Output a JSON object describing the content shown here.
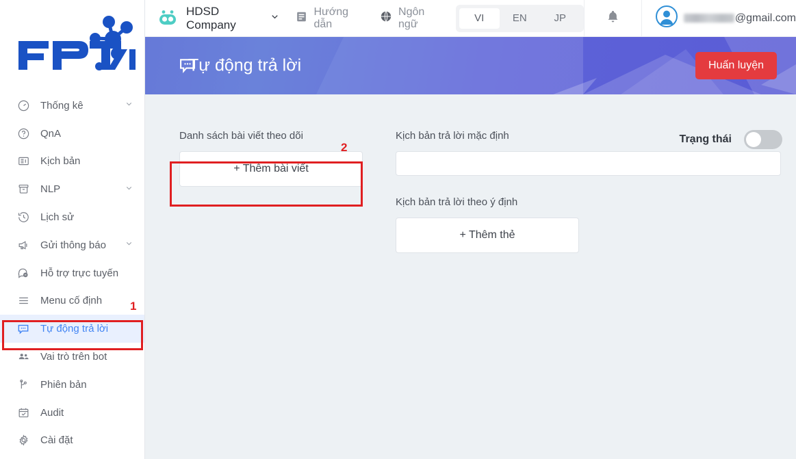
{
  "brand": {
    "logo_text": "FPT.AI",
    "accent": "#1a52c4"
  },
  "header": {
    "bot_icon": "robot-icon",
    "company": "HDSD Company",
    "company_chevron": "chevron-down-icon",
    "guide_label": "Hướng dẫn",
    "guide_icon": "document-icon",
    "language_label": "Ngôn ngữ",
    "language_icon": "globe-icon",
    "languages": [
      {
        "code": "VI",
        "selected": true
      },
      {
        "code": "EN",
        "selected": false
      },
      {
        "code": "JP",
        "selected": false
      }
    ],
    "notification_icon": "bell-icon",
    "avatar_icon": "user-avatar-icon",
    "account_email_suffix": "@gmail.com"
  },
  "banner": {
    "icon": "speech-bubble-icon",
    "title": "Tự động trả lời",
    "action_label": "Huấn luyện",
    "action_color": "#e43b3f"
  },
  "sidebar": {
    "items": [
      {
        "label": "Thống kê",
        "icon": "gauge-icon",
        "chevron": true,
        "active": false
      },
      {
        "label": "QnA",
        "icon": "question-circle-icon",
        "chevron": false,
        "active": false
      },
      {
        "label": "Kịch bản",
        "icon": "article-icon",
        "chevron": false,
        "active": false
      },
      {
        "label": "NLP",
        "icon": "archive-box-icon",
        "chevron": true,
        "active": false
      },
      {
        "label": "Lịch sử",
        "icon": "history-clock-icon",
        "chevron": false,
        "active": false
      },
      {
        "label": "Gửi thông báo",
        "icon": "megaphone-icon",
        "chevron": true,
        "active": false
      },
      {
        "label": "Hỗ trợ trực tuyến",
        "icon": "chat-support-icon",
        "chevron": false,
        "active": false
      },
      {
        "label": "Menu cố định",
        "icon": "hamburger-icon",
        "chevron": false,
        "active": false
      },
      {
        "label": "Tự động trả lời",
        "icon": "speech-bubble-icon",
        "chevron": false,
        "active": true
      },
      {
        "label": "Vai trò trên bot",
        "icon": "people-icon",
        "chevron": false,
        "active": false
      },
      {
        "label": "Phiên bản",
        "icon": "branch-icon",
        "chevron": false,
        "active": false
      },
      {
        "label": "Audit",
        "icon": "calendar-check-icon",
        "chevron": false,
        "active": false
      },
      {
        "label": "Cài đặt",
        "icon": "gear-icon",
        "chevron": false,
        "active": false
      }
    ]
  },
  "main": {
    "tracked_posts_label": "Danh sách bài viết theo dõi",
    "add_post_button": "+ Thêm bài viết",
    "default_reply_label": "Kịch bản trả lời mặc định",
    "default_reply_value": "",
    "status_label": "Trạng thái",
    "status_on": false,
    "intent_reply_label": "Kịch bản trả lời theo ý định",
    "add_tag_button": "+ Thêm thẻ"
  },
  "annotations": {
    "color": "#e01f21",
    "markers": [
      {
        "number": "1",
        "target": "sidebar-item-auto-reply"
      },
      {
        "number": "2",
        "target": "add-post-button"
      }
    ]
  }
}
